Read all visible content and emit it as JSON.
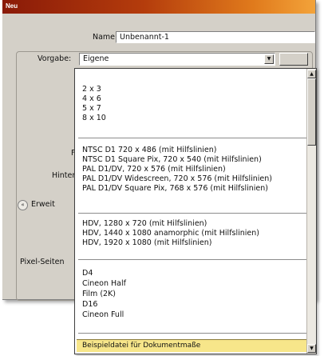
{
  "window": {
    "title": "Neu"
  },
  "form": {
    "name_label": "Name:",
    "name_value": "Unbenannt-1",
    "preset_label": "Vorgabe:",
    "preset_value": "Eigene",
    "label_partial_f": "F",
    "label_hintergr": "Hinterg",
    "label_erweitert": "Erweit",
    "label_pixel": "Pixel-Seiten"
  },
  "dropdown": {
    "photo_sizes": [
      "2 x 3",
      "4 x 6",
      "5 x 7",
      "8 x 10"
    ],
    "video_sd": [
      "NTSC D1 720 x 486 (mit Hilfslinien)",
      "NTSC D1 Square Pix, 720 x 540 (mit Hilfslinien)",
      "PAL D1/DV, 720 x 576 (mit Hilfslinien)",
      "PAL D1/DV Widescreen, 720 x 576 (mit Hilfslinien)",
      "PAL D1/DV Square Pix, 768 x 576 (mit Hilfslinien)"
    ],
    "video_hd": [
      "HDV, 1280 x 720 (mit Hilfslinien)",
      "HDV, 1440 x 1080 anamorphic (mit Hilfslinien)",
      "HDV, 1920 x 1080 (mit Hilfslinien)"
    ],
    "film": [
      "D4",
      "Cineon Half",
      "Film (2K)",
      "D16",
      "Cineon Full"
    ],
    "selected_item": "Beispieldatei für Dokumentmaße"
  },
  "icons": {
    "dropdown_arrow": "chevron-down-icon",
    "scroll_up": "scroll-up-icon",
    "scroll_down": "scroll-down-icon",
    "expand": "expand-icon"
  }
}
